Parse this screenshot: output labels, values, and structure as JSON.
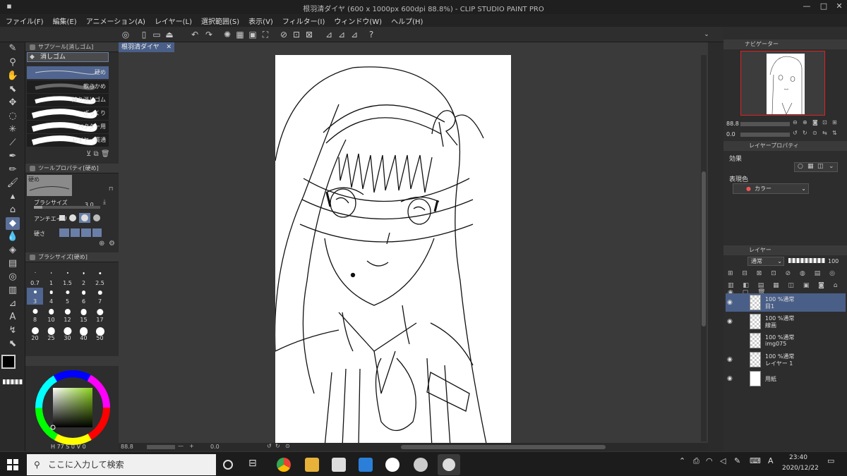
{
  "window": {
    "title": "根羽清ダイヤ (600 x 1000px 600dpi 88.8%)  - CLIP STUDIO PAINT PRO"
  },
  "menu": [
    "ファイル(F)",
    "編集(E)",
    "アニメーション(A)",
    "レイヤー(L)",
    "選択範囲(S)",
    "表示(V)",
    "フィルター(I)",
    "ウィンドウ(W)",
    "ヘルプ(H)"
  ],
  "subtool": {
    "header": "サブツール[消しゴム]",
    "active": "消しゴム",
    "brushes": [
      "硬め",
      "軟らかめ",
      "練り消しゴム",
      "ざっくり",
      "ベクター用",
      "レイヤー貫通"
    ]
  },
  "toolprop": {
    "header": "ツールプロパティ[硬め]",
    "preset": "硬め",
    "size_label": "ブラシサイズ",
    "size_value": "3.0",
    "aa_label": "アンチエイリ",
    "hardness_label": "硬さ"
  },
  "brushsize": {
    "header": "ブラシサイズ[硬め]",
    "values": [
      "0.7",
      "1",
      "1.5",
      "2",
      "2.5",
      "3",
      "4",
      "5",
      "6",
      "7",
      "8",
      "10",
      "12",
      "15",
      "17",
      "20",
      "25",
      "30",
      "40",
      "50"
    ],
    "selected": "3"
  },
  "color": {
    "h": "77",
    "s": "0",
    "v": "0",
    "h_label": "H",
    "s_label": "S",
    "v_label": "V"
  },
  "document": {
    "tab": "根羽清ダイヤ",
    "zoom": "88.8",
    "angle": "0.0"
  },
  "navigator": {
    "tab": "ナビゲーター",
    "zoom": "88.8",
    "angle": "0.0"
  },
  "layer_property": {
    "tab": "レイヤープロパティ",
    "effect_label": "効果",
    "expression_label": "表現色",
    "expression_value": "カラー"
  },
  "layers_panel": {
    "tab": "レイヤー",
    "blend": "通常",
    "opacity": "100",
    "layers": [
      {
        "opacity_mode": "100 %通常",
        "name": "目1",
        "visible": true,
        "selected": true
      },
      {
        "opacity_mode": "100 %通常",
        "name": "線画",
        "visible": true,
        "selected": false
      },
      {
        "opacity_mode": "100 %通常",
        "name": "img075",
        "visible": false,
        "selected": false
      },
      {
        "opacity_mode": "100 %通常",
        "name": "レイヤー 1",
        "visible": true,
        "selected": false
      },
      {
        "opacity_mode": "",
        "name": "用紙",
        "visible": true,
        "selected": false
      }
    ]
  },
  "taskbar": {
    "search_placeholder": "ここに入力して検索",
    "time": "23:40",
    "date": "2020/12/22",
    "ime": "A"
  }
}
